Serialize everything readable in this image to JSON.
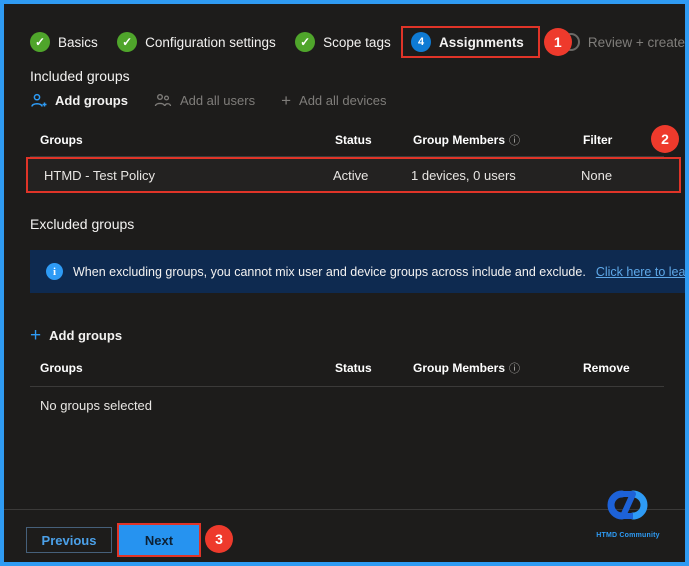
{
  "wizard": {
    "steps": [
      {
        "label": "Basics",
        "state": "done"
      },
      {
        "label": "Configuration settings",
        "state": "done"
      },
      {
        "label": "Scope tags",
        "state": "done"
      },
      {
        "label": "Assignments",
        "state": "current",
        "number": "4"
      },
      {
        "label": "Review + create",
        "state": "upcoming"
      }
    ]
  },
  "annotations": {
    "badge1": "1",
    "badge2": "2",
    "badge3": "3"
  },
  "icons": {
    "check": "✓",
    "plus": "+",
    "banner_info": "i",
    "column_info": "ⓘ"
  },
  "included": {
    "heading": "Included groups",
    "toolbar": {
      "add_groups": "Add groups",
      "add_all_users": "Add all users",
      "add_all_devices": "Add all devices"
    },
    "table": {
      "headers": [
        "Groups",
        "Status",
        "Group Members",
        "Filter"
      ],
      "rows": [
        [
          "HTMD - Test Policy",
          "Active",
          "1 devices, 0 users",
          "None"
        ]
      ]
    }
  },
  "excluded": {
    "heading": "Excluded groups",
    "banner": {
      "text": "When excluding groups, you cannot mix user and device groups across include and exclude.",
      "link": "Click here to learn more abou"
    },
    "add_groups": "Add groups",
    "table": {
      "headers": [
        "Groups",
        "Status",
        "Group Members",
        "Remove"
      ],
      "empty_text": "No groups selected"
    }
  },
  "footer": {
    "previous": "Previous",
    "next": "Next"
  },
  "logo": {
    "text": "HTMD Community"
  },
  "colors": {
    "accent_blue": "#2f9bf3",
    "step_green": "#4fa52b",
    "step_blue": "#0f7bd4",
    "annotation_red": "#ee3a2c",
    "banner_bg": "#0e2a50",
    "link_blue": "#5ea8e8"
  }
}
